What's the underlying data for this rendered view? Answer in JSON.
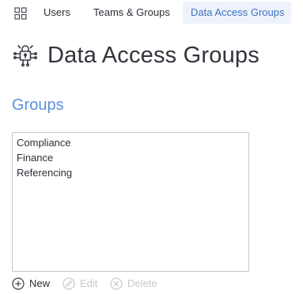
{
  "nav": {
    "grid_icon": "grid-icon",
    "items": [
      {
        "label": "Users"
      },
      {
        "label": "Teams & Groups"
      },
      {
        "label": "Data Access Groups",
        "active": true
      }
    ],
    "active_bg": "#eef3fb",
    "active_color": "#3e72c0"
  },
  "header": {
    "icon": "lock-network-icon",
    "title": "Data Access Groups"
  },
  "groups": {
    "section_title": "Groups",
    "items": [
      "Compliance",
      "Finance",
      "Referencing"
    ]
  },
  "actions": {
    "new": {
      "label": "New",
      "icon": "plus-circle-icon",
      "enabled": true
    },
    "edit": {
      "label": "Edit",
      "icon": "pencil-circle-icon",
      "enabled": false
    },
    "delete": {
      "label": "Delete",
      "icon": "x-circle-icon",
      "enabled": false
    }
  },
  "colors": {
    "accent": "#5b8fdc",
    "disabled": "#c6c9ce"
  }
}
